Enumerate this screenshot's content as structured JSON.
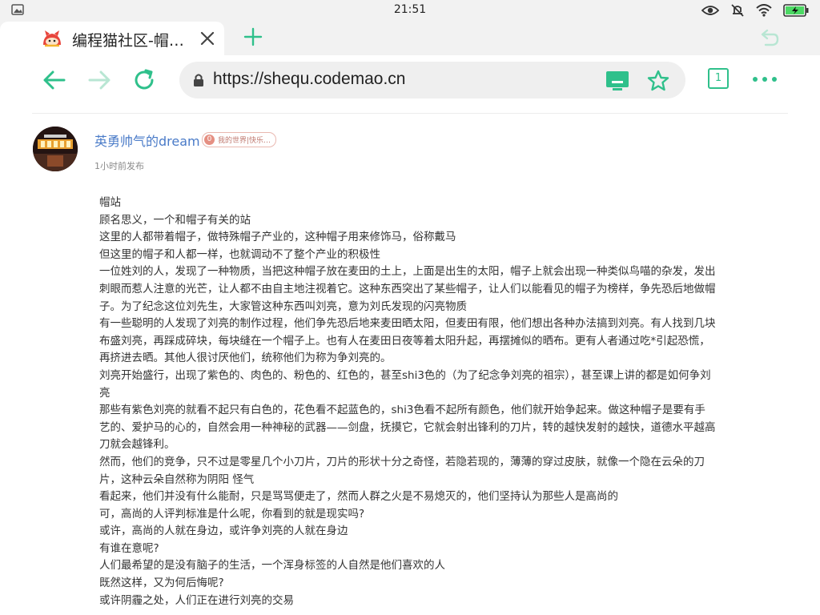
{
  "status_bar": {
    "time": "21:51"
  },
  "tab": {
    "title": "编程猫社区-帽…"
  },
  "toolbar": {
    "url": "https://shequ.codemao.cn",
    "tab_count": "1"
  },
  "colors": {
    "accent": "#2fc08b",
    "author_link": "#4a7bc8"
  },
  "post": {
    "author": "英勇帅气的dream",
    "badge_level": "0",
    "badge_text": "我的世界|快乐…",
    "time": "1小时前发布",
    "lines": [
      "帽站",
      "顾名思义，一个和帽子有关的站",
      "这里的人都带着帽子，做特殊帽子产业的，这种帽子用来修饰马，俗称戴马",
      "但这里的帽子和人都一样，也就调动不了整个产业的积极性",
      "一位姓刘的人，发现了一种物质，当把这种帽子放在麦田的土上，上面是出生的太阳，帽子上就会出现一种类似鸟喵的杂发，发出刺眼而惹人注意的光芒，让人都不由自主地注视着它。这种东西突出了某些帽子，让人们以能看见的帽子为榜样，争先恐后地做帽子。为了纪念这位刘先生，大家管这种东西叫刘亮，意为刘氏发现的闪亮物质",
      "有一些聪明的人发现了刘亮的制作过程，他们争先恐后地来麦田晒太阳，但麦田有限，他们想出各种办法搞到刘亮。有人找到几块布盛刘亮，再踩成碎块，每块缝在一个帽子上。也有人在麦田日夜等着太阳升起，再摆摊似的晒布。更有人者通过吃*引起恐慌，再挤进去晒。其他人很讨厌他们，统称他们为称为争刘亮的。",
      "刘亮开始盛行，出现了紫色的、肉色的、粉色的、红色的，甚至shi3色的（为了纪念争刘亮的祖宗），甚至课上讲的都是如何争刘亮",
      "那些有紫色刘亮的就看不起只有白色的，花色看不起蓝色的，shi3色看不起所有颜色，他们就开始争起来。做这种帽子是要有手艺的、爱护马的心的，自然会用一种神秘的武器——剑盘，抚摸它，它就会射出锋利的刀片，转的越快发射的越快，道德水平越高刀就会越锋利。",
      "然而，他们的竞争，只不过是零星几个小刀片，刀片的形状十分之奇怪，若隐若现的，薄薄的穿过皮肤，就像一个隐在云朵的刀片，这种云朵自然称为阴阳 怪气",
      "看起来，他们并没有什么能耐，只是骂骂便走了，然而人群之火是不易熄灭的，他们坚持认为那些人是高尚的",
      "可，高尚的人评判标准是什么呢，你看到的就是现实吗?",
      "或许，高尚的人就在身边，或许争刘亮的人就在身边",
      "有谁在意呢?",
      "人们最希望的是没有脑子的生活，一个浑身标签的人自然是他们喜欢的人",
      "既然这样，又为何后悔呢?",
      "或许阴霾之处，人们正在进行刘亮的交易"
    ]
  }
}
